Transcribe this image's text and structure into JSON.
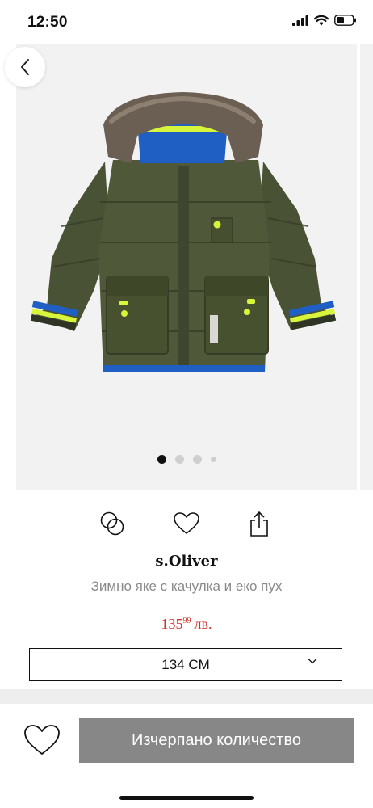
{
  "status_bar": {
    "time": "12:50"
  },
  "gallery": {
    "image_alt": "s.Oliver jacket",
    "image_count": 4,
    "active_index": 0
  },
  "actions": {
    "compare_icon": "compare-icon",
    "favorite_icon": "heart-icon",
    "share_icon": "share-icon"
  },
  "product": {
    "brand": "s.Oliver",
    "name": "Зимно яке с качулка и еко пух",
    "price_int": "135",
    "price_frac": "99",
    "currency": "лв."
  },
  "size_select": {
    "selected": "134 CM"
  },
  "bottom_bar": {
    "cta_label": "Изчерпано количество"
  },
  "colors": {
    "price": "#d0312d",
    "cta_bg": "#878787",
    "jacket": "#4a5236",
    "hood_lining": "#1f5fc4",
    "neon": "#d6f53b"
  }
}
